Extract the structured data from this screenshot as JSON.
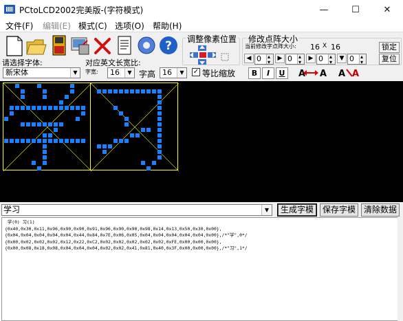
{
  "window": {
    "title": "PCtoLCD2002完美版-(字符模式)",
    "min_glyph": "—",
    "max_glyph": "☐",
    "close_glyph": "✕"
  },
  "menu": [
    {
      "label": "文件(F)",
      "enabled": true
    },
    {
      "label": "编辑(E)",
      "enabled": false
    },
    {
      "label": "模式(C)",
      "enabled": true
    },
    {
      "label": "选项(O)",
      "enabled": true
    },
    {
      "label": "帮助(H)",
      "enabled": true
    }
  ],
  "toolbar": {
    "icons": [
      "new-file-icon",
      "open-folder-icon",
      "save-disk-icon",
      "import-image-icon",
      "delete-x-icon",
      "notes-icon",
      "settings-gear-icon",
      "help-question-icon"
    ],
    "font_label": "请选择字体:",
    "font_value": "新宋体",
    "width_ratio_label": "对应英文长宽比:",
    "char_width_label": "字宽:",
    "char_width_value": "16",
    "char_height_label": "字高",
    "char_height_value": "16",
    "proportional_label": "等比缩放",
    "proportional_checked": true,
    "bold_label": "B",
    "italic_label": "I",
    "underline_label": "U"
  },
  "pixel_position": {
    "title": "调整像素位置"
  },
  "dot_matrix": {
    "title": "修改点阵大小",
    "current_label": "当前修改字点阵大小:",
    "width": "16",
    "x": "X",
    "height": "16",
    "lock_label": "锁定",
    "restore_label": "复位",
    "spinners": [
      "0",
      "0",
      "0",
      "0"
    ]
  },
  "glyphs": [
    {
      "char": "学"
    },
    {
      "char": "习"
    }
  ],
  "bottom": {
    "input_text": "学习",
    "generate_label": "生成字模",
    "save_label": "保存字模",
    "clear_label": "清除数据"
  },
  "output_lines": [
    " 学(0) 习(1)",
    "",
    "{0x40,0x30,0x11,0x96,0x90,0x90,0x91,0x96,0x90,0x90,0x98,0x14,0x13,0x50,0x30,0x00},",
    "{0x04,0x04,0x04,0x04,0x04,0x44,0x84,0x7E,0x06,0x05,0x04,0x04,0x04,0x04,0x04,0x00},/*\"学\",0*/",
    "",
    "{0x00,0x02,0x02,0x02,0x12,0x22,0xC2,0x02,0x02,0x02,0x02,0x02,0xFE,0x00,0x00,0x00},",
    "{0x00,0x08,0x18,0x08,0x04,0x04,0x04,0x02,0x02,0x41,0x81,0x40,0x3F,0x00,0x00,0x00},/*\"习\",1*/"
  ],
  "colors": {
    "pixel_on": "#1c7fff",
    "grid_border": "#ffff00",
    "canvas_bg": "#000000"
  }
}
